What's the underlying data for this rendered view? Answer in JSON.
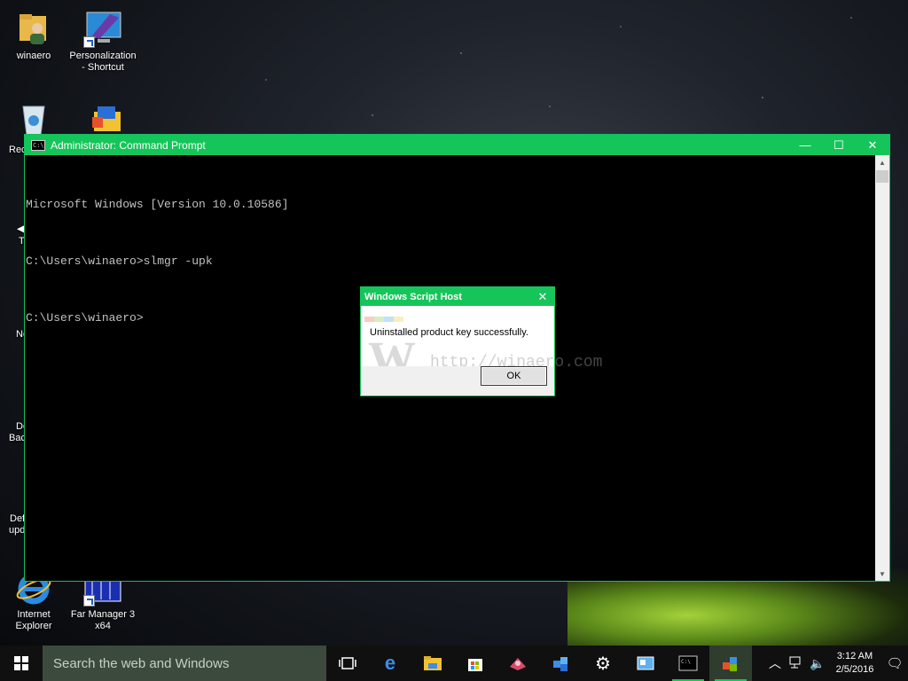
{
  "desktop": {
    "icons": [
      {
        "label": "winaero",
        "icon": "user-folder-icon"
      },
      {
        "label": "Personalization - Shortcut",
        "icon": "personalization-icon"
      },
      {
        "label": "Rec",
        "icon": "recycle-bin-icon"
      },
      {
        "label": "Internet Explorer",
        "icon": "internet-explorer-icon"
      },
      {
        "label": "Far Manager 3 x64",
        "icon": "far-manager-icon"
      }
    ],
    "partial_labels": [
      "T",
      "Ne",
      "De",
      "Bac",
      "Def",
      "upd"
    ]
  },
  "cmd_window": {
    "title": "Administrator: Command Prompt",
    "lines": [
      "Microsoft Windows [Version 10.0.10586]",
      "C:\\Users\\winaero>slmgr -upk",
      "C:\\Users\\winaero>"
    ],
    "minimize_glyph": "—",
    "maximize_glyph": "☐",
    "close_glyph": "✕"
  },
  "dialog": {
    "title": "Windows Script Host",
    "message": "Uninstalled product key successfully.",
    "ok_label": "OK",
    "close_glyph": "✕",
    "watermark_url": "http://winaero.com"
  },
  "taskbar": {
    "search_placeholder": "Search the web and Windows",
    "apps": [
      "task-view-icon",
      "edge-icon",
      "file-explorer-icon",
      "store-icon",
      "app1-icon",
      "app2-icon",
      "settings-icon",
      "app3-icon",
      "cmd-icon",
      "app4-icon"
    ],
    "clock_time": "3:12 AM",
    "clock_date": "2/5/2016"
  },
  "colors": {
    "accent": "#16c55a",
    "taskbar": "#101010",
    "search_box": "#3c4a3e"
  }
}
